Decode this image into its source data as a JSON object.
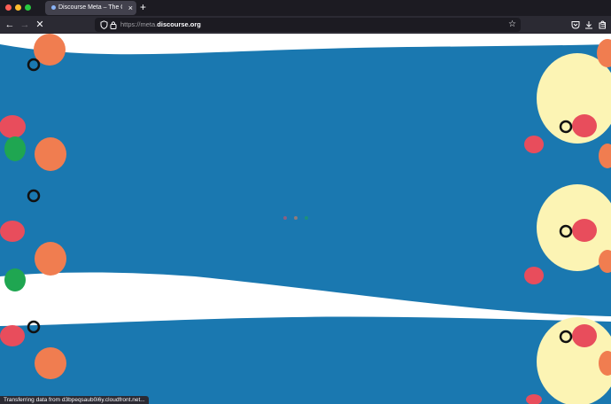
{
  "browser": {
    "tab_title": "Discourse Meta – The Official D",
    "url_prefix": "https://meta.",
    "url_domain": "discourse.org",
    "status_text": "Transferring data from d3bpeqsaub0i6y.cloudfront.net..."
  },
  "colors": {
    "background_blue": "#1a78b0",
    "band_white": "#ffffff",
    "orange_blob": "#f07d50",
    "red_blob": "#e84d5c",
    "green_blob": "#1fa651",
    "cream_blob": "#fcf4b4"
  },
  "icons": [
    "back-arrow-icon",
    "forward-arrow-icon",
    "stop-loading-icon",
    "shield-icon",
    "lock-icon",
    "star-bookmark-icon",
    "pocket-icon",
    "downloads-icon",
    "extensions-icon",
    "menu-icon"
  ],
  "loading": {
    "state": "loading"
  }
}
